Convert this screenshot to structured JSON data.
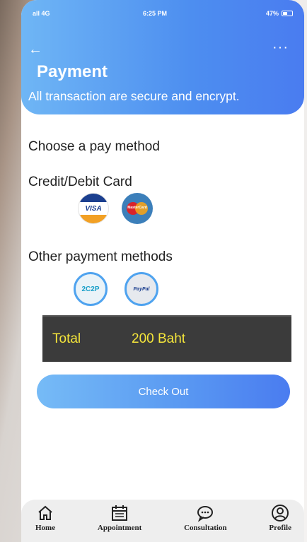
{
  "status_bar": {
    "signal": "all 4G",
    "time": "6:25 PM",
    "battery": "47%"
  },
  "header": {
    "back_icon": "arrow-left-icon",
    "more_icon": "more-dots-icon",
    "title": "Payment",
    "subtitle": "All transaction are secure and encrypt."
  },
  "content": {
    "choose_label": "Choose a pay method",
    "card_label": "Credit/Debit Card",
    "card_methods": [
      {
        "name": "VISA",
        "icon": "visa-icon"
      },
      {
        "name": "MasterCard",
        "icon": "mastercard-icon"
      }
    ],
    "other_label": "Other payment methods",
    "other_methods": [
      {
        "name": "2C2P",
        "icon": "2c2p-icon"
      },
      {
        "name": "PayPal",
        "icon": "paypal-icon"
      }
    ]
  },
  "total": {
    "label": "Total",
    "amount": "200 Baht"
  },
  "checkout_label": "Check Out",
  "nav": {
    "items": [
      {
        "label": "Home",
        "icon": "home-icon"
      },
      {
        "label": "Appointment",
        "icon": "calendar-icon"
      },
      {
        "label": "Consultation",
        "icon": "chat-bubble-icon"
      },
      {
        "label": "Profile",
        "icon": "user-icon"
      }
    ]
  },
  "colors": {
    "header_start": "#6fb6f5",
    "header_end": "#4a7cf0",
    "total_bg": "#3b3b3b",
    "total_text": "#f5e63b"
  }
}
